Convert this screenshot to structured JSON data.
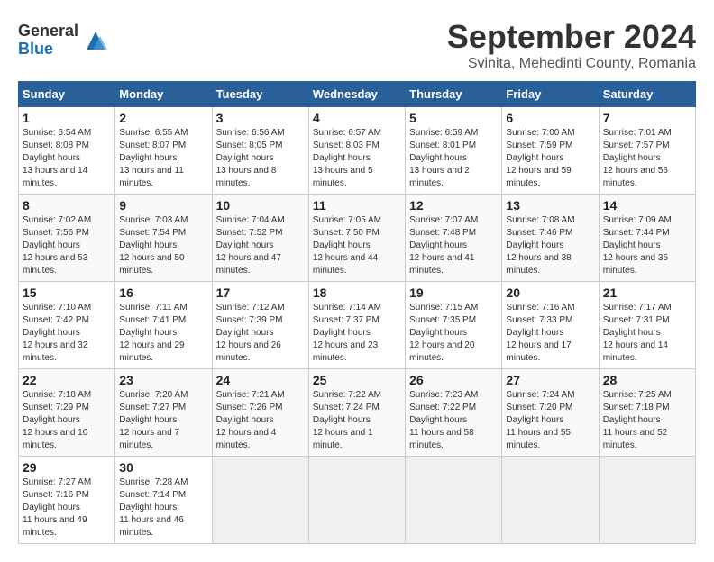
{
  "header": {
    "logo_line1": "General",
    "logo_line2": "Blue",
    "month_title": "September 2024",
    "location": "Svinita, Mehedinti County, Romania"
  },
  "weekdays": [
    "Sunday",
    "Monday",
    "Tuesday",
    "Wednesday",
    "Thursday",
    "Friday",
    "Saturday"
  ],
  "weeks": [
    [
      {
        "day": "1",
        "sunrise": "6:54 AM",
        "sunset": "8:08 PM",
        "daylight": "13 hours and 14 minutes."
      },
      {
        "day": "2",
        "sunrise": "6:55 AM",
        "sunset": "8:07 PM",
        "daylight": "13 hours and 11 minutes."
      },
      {
        "day": "3",
        "sunrise": "6:56 AM",
        "sunset": "8:05 PM",
        "daylight": "13 hours and 8 minutes."
      },
      {
        "day": "4",
        "sunrise": "6:57 AM",
        "sunset": "8:03 PM",
        "daylight": "13 hours and 5 minutes."
      },
      {
        "day": "5",
        "sunrise": "6:59 AM",
        "sunset": "8:01 PM",
        "daylight": "13 hours and 2 minutes."
      },
      {
        "day": "6",
        "sunrise": "7:00 AM",
        "sunset": "7:59 PM",
        "daylight": "12 hours and 59 minutes."
      },
      {
        "day": "7",
        "sunrise": "7:01 AM",
        "sunset": "7:57 PM",
        "daylight": "12 hours and 56 minutes."
      }
    ],
    [
      {
        "day": "8",
        "sunrise": "7:02 AM",
        "sunset": "7:56 PM",
        "daylight": "12 hours and 53 minutes."
      },
      {
        "day": "9",
        "sunrise": "7:03 AM",
        "sunset": "7:54 PM",
        "daylight": "12 hours and 50 minutes."
      },
      {
        "day": "10",
        "sunrise": "7:04 AM",
        "sunset": "7:52 PM",
        "daylight": "12 hours and 47 minutes."
      },
      {
        "day": "11",
        "sunrise": "7:05 AM",
        "sunset": "7:50 PM",
        "daylight": "12 hours and 44 minutes."
      },
      {
        "day": "12",
        "sunrise": "7:07 AM",
        "sunset": "7:48 PM",
        "daylight": "12 hours and 41 minutes."
      },
      {
        "day": "13",
        "sunrise": "7:08 AM",
        "sunset": "7:46 PM",
        "daylight": "12 hours and 38 minutes."
      },
      {
        "day": "14",
        "sunrise": "7:09 AM",
        "sunset": "7:44 PM",
        "daylight": "12 hours and 35 minutes."
      }
    ],
    [
      {
        "day": "15",
        "sunrise": "7:10 AM",
        "sunset": "7:42 PM",
        "daylight": "12 hours and 32 minutes."
      },
      {
        "day": "16",
        "sunrise": "7:11 AM",
        "sunset": "7:41 PM",
        "daylight": "12 hours and 29 minutes."
      },
      {
        "day": "17",
        "sunrise": "7:12 AM",
        "sunset": "7:39 PM",
        "daylight": "12 hours and 26 minutes."
      },
      {
        "day": "18",
        "sunrise": "7:14 AM",
        "sunset": "7:37 PM",
        "daylight": "12 hours and 23 minutes."
      },
      {
        "day": "19",
        "sunrise": "7:15 AM",
        "sunset": "7:35 PM",
        "daylight": "12 hours and 20 minutes."
      },
      {
        "day": "20",
        "sunrise": "7:16 AM",
        "sunset": "7:33 PM",
        "daylight": "12 hours and 17 minutes."
      },
      {
        "day": "21",
        "sunrise": "7:17 AM",
        "sunset": "7:31 PM",
        "daylight": "12 hours and 14 minutes."
      }
    ],
    [
      {
        "day": "22",
        "sunrise": "7:18 AM",
        "sunset": "7:29 PM",
        "daylight": "12 hours and 10 minutes."
      },
      {
        "day": "23",
        "sunrise": "7:20 AM",
        "sunset": "7:27 PM",
        "daylight": "12 hours and 7 minutes."
      },
      {
        "day": "24",
        "sunrise": "7:21 AM",
        "sunset": "7:26 PM",
        "daylight": "12 hours and 4 minutes."
      },
      {
        "day": "25",
        "sunrise": "7:22 AM",
        "sunset": "7:24 PM",
        "daylight": "12 hours and 1 minute."
      },
      {
        "day": "26",
        "sunrise": "7:23 AM",
        "sunset": "7:22 PM",
        "daylight": "11 hours and 58 minutes."
      },
      {
        "day": "27",
        "sunrise": "7:24 AM",
        "sunset": "7:20 PM",
        "daylight": "11 hours and 55 minutes."
      },
      {
        "day": "28",
        "sunrise": "7:25 AM",
        "sunset": "7:18 PM",
        "daylight": "11 hours and 52 minutes."
      }
    ],
    [
      {
        "day": "29",
        "sunrise": "7:27 AM",
        "sunset": "7:16 PM",
        "daylight": "11 hours and 49 minutes."
      },
      {
        "day": "30",
        "sunrise": "7:28 AM",
        "sunset": "7:14 PM",
        "daylight": "11 hours and 46 minutes."
      },
      null,
      null,
      null,
      null,
      null
    ]
  ]
}
